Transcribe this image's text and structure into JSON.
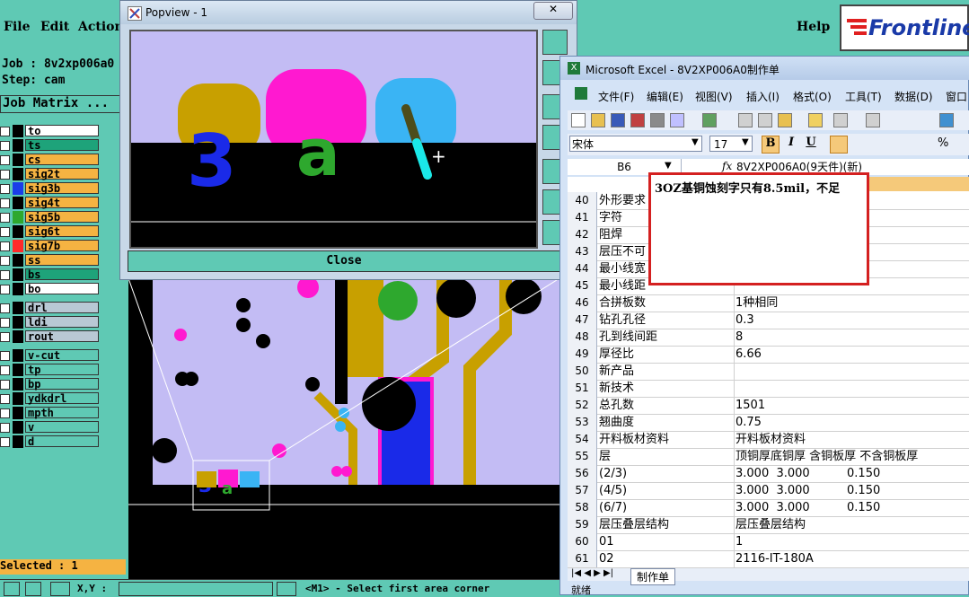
{
  "cam": {
    "menu": {
      "file": "File",
      "edit": "Edit",
      "actions": "Actions",
      "help": "Help"
    },
    "logo": "Frontline",
    "job": "Job : 8v2xp006a0",
    "step": "Step: cam",
    "job_matrix": "Job Matrix ...",
    "layers": [
      {
        "name": "to",
        "ind": "#000",
        "bg": "#fff"
      },
      {
        "name": "ts",
        "ind": "#000",
        "bg": "#1ea37a"
      },
      {
        "name": "cs",
        "ind": "#000",
        "bg": "#f5b342"
      },
      {
        "name": "sig2t",
        "ind": "#000",
        "bg": "#f5b342"
      },
      {
        "name": "sig3b",
        "ind": "#1a3de8",
        "bg": "#f5b342"
      },
      {
        "name": "sig4t",
        "ind": "#000",
        "bg": "#f5b342"
      },
      {
        "name": "sig5b",
        "ind": "#2ea82e",
        "bg": "#f5b342"
      },
      {
        "name": "sig6t",
        "ind": "#000",
        "bg": "#f5b342"
      },
      {
        "name": "sig7b",
        "ind": "#ff2a2a",
        "bg": "#f5b342"
      },
      {
        "name": "ss",
        "ind": "#000",
        "bg": "#f5b342"
      },
      {
        "name": "bs",
        "ind": "#000",
        "bg": "#1ea37a"
      },
      {
        "name": "bo",
        "ind": "#000",
        "bg": "#fff"
      }
    ],
    "drill_layers": [
      "drl",
      "ldi",
      "rout"
    ],
    "other_layers": [
      "v-cut",
      "tp",
      "bp",
      "ydkdrl",
      "mpth",
      "v",
      "d"
    ],
    "selected": "Selected : 1",
    "status_left": "X,Y :",
    "status_prompt": "<M1> - Select first area corner"
  },
  "popview": {
    "title": "Popview - 1",
    "close": "Close"
  },
  "excel": {
    "title": "Microsoft Excel - 8V2XP006A0制作单",
    "menu": [
      "文件(F)",
      "编辑(E)",
      "视图(V)",
      "插入(I)",
      "格式(O)",
      "工具(T)",
      "数据(D)",
      "窗口"
    ],
    "font": "宋体",
    "font_size": "17",
    "cell_ref": "B6",
    "formula": "8V2XP006A0(9天件)(新)",
    "comment": "3OZ基铜蚀刻字只有8.5mil，不足",
    "rows": [
      {
        "n": "40",
        "a": "外形要求",
        "b": ""
      },
      {
        "n": "41",
        "a": "字符",
        "b": ""
      },
      {
        "n": "42",
        "a": "阻焊",
        "b": ""
      },
      {
        "n": "43",
        "a": "层压不可",
        "b": ""
      },
      {
        "n": "44",
        "a": "最小线宽",
        "b": ""
      },
      {
        "n": "45",
        "a": "最小线距",
        "b": ""
      },
      {
        "n": "46",
        "a": "合拼板数",
        "b": "1种相同"
      },
      {
        "n": "47",
        "a": "钻孔孔径",
        "b": "0.3"
      },
      {
        "n": "48",
        "a": "孔到线间距",
        "b": "8"
      },
      {
        "n": "49",
        "a": "厚径比",
        "b": "6.66"
      },
      {
        "n": "50",
        "a": "新产品",
        "b": ""
      },
      {
        "n": "51",
        "a": "新技术",
        "b": ""
      },
      {
        "n": "52",
        "a": "总孔数",
        "b": "1501"
      },
      {
        "n": "53",
        "a": "翘曲度",
        "b": "0.75"
      },
      {
        "n": "54",
        "a": "开料板材资料",
        "b": "开料板材资料"
      },
      {
        "n": "55",
        "a": "层",
        "b": "顶铜厚底铜厚 含铜板厚 不含铜板厚"
      },
      {
        "n": "56",
        "a": "(2/3)",
        "b": "3.000  3.000          0.150"
      },
      {
        "n": "57",
        "a": "(4/5)",
        "b": "3.000  3.000          0.150"
      },
      {
        "n": "58",
        "a": "(6/7)",
        "b": "3.000  3.000          0.150"
      },
      {
        "n": "59",
        "a": "层压叠层结构",
        "b": "层压叠层结构"
      },
      {
        "n": "60",
        "a": "01",
        "b": "1"
      },
      {
        "n": "61",
        "a": "02",
        "b": "2116-IT-180A"
      }
    ],
    "sheet_tab": "制作单",
    "status": "就绪"
  }
}
